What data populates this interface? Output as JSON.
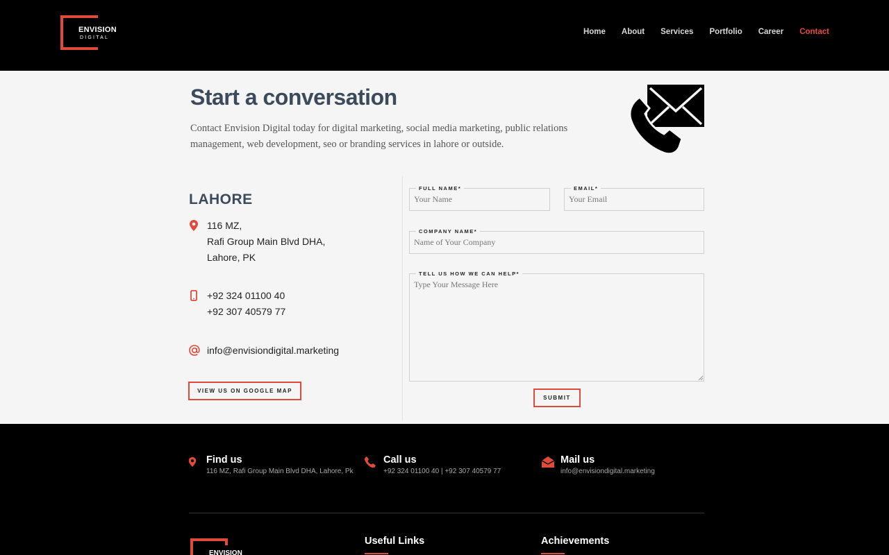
{
  "brand": {
    "name_line1": "ENVISION",
    "name_line2": "DIGITAL",
    "accent": "#e04a3a"
  },
  "nav": [
    {
      "label": "Home"
    },
    {
      "label": "About"
    },
    {
      "label": "Services"
    },
    {
      "label": "Portfolio"
    },
    {
      "label": "Career"
    },
    {
      "label": "Contact",
      "active": true
    }
  ],
  "hero": {
    "title": "Start a conversation",
    "intro": "Contact Envision Digital today for digital marketing, social media marketing, public relations management, web development, seo or branding services in lahore or outside.",
    "icon": "phone-envelope-icon"
  },
  "office": {
    "city": "LAHORE",
    "address": [
      "116 MZ,",
      "Rafi Group Main Blvd DHA,",
      "Lahore, PK"
    ],
    "phones": [
      "+92 324 01100 40",
      "+92 307 40579 77"
    ],
    "email": "info@envisiondigital.marketing",
    "map_button": "VIEW US ON GOOGLE MAP"
  },
  "form": {
    "full_name": {
      "label": "FULL NAME*",
      "placeholder": "Your Name",
      "value": ""
    },
    "email": {
      "label": "EMAIL*",
      "placeholder": "Your Email",
      "value": ""
    },
    "company": {
      "label": "COMPANY NAME*",
      "placeholder": "Name of Your Company",
      "value": ""
    },
    "message": {
      "label": "TELL US HOW WE CAN HELP*",
      "placeholder": "Type Your Message Here",
      "value": ""
    },
    "submit": "SUBMIT"
  },
  "footer": {
    "find": {
      "title": "Find us",
      "text": "116 MZ, Rafi Group Main Blvd DHA, Lahore, Pk"
    },
    "call": {
      "title": "Call us",
      "text": "+92 324 01100 40 | +92 307 40579 77"
    },
    "mail": {
      "title": "Mail us",
      "text": "info@envisiondigital.marketing"
    },
    "logo_text": "ENVISION",
    "useful_links": "Useful Links",
    "achievements": "Achievements"
  }
}
